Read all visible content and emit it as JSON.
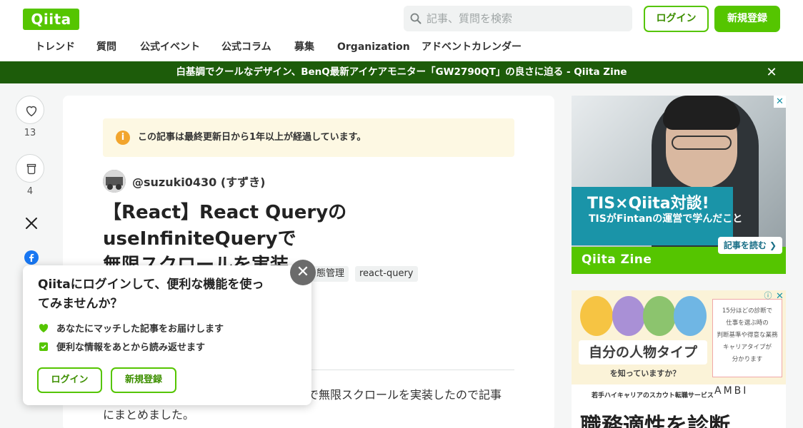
{
  "header": {
    "logo": "Qiita",
    "search_placeholder": "記事、質問を検索",
    "login": "ログイン",
    "signup": "新規登録",
    "nav": [
      "トレンド",
      "質問",
      "公式イベント",
      "公式コラム",
      "募集",
      "Organization",
      "アドベントカレンダー"
    ]
  },
  "banner": {
    "text": "白基調でクールなデザイン、BenQ最新アイケアモニター「GW2790QT」の良さに迫る - Qiita Zine",
    "close": "✕"
  },
  "actions": {
    "likes": "13",
    "stocks": "4"
  },
  "article": {
    "notice": "この記事は最終更新日から1年以上が経過しています。",
    "author": "@suzuki0430 (すずき)",
    "title_line1": "【React】React QueryのuseInfiniteQueryで",
    "title_line2": "無限スクロールを実装",
    "tags": [
      "態管理",
      "react-query"
    ],
    "body_line1": "で無限スクロールを実装したので記事",
    "body_line2": "にまとめました。"
  },
  "popup": {
    "title_line1": "Qiitaにログインして、便利な機能を使っ",
    "title_line2": "てみませんか？",
    "features": [
      "あなたにマッチした記事をお届けします",
      "便利な情報をあとから読み返せます"
    ],
    "login": "ログイン",
    "signup": "新規登録",
    "close": "✕"
  },
  "ads": {
    "ad1": {
      "headline": "TIS×Qiita対談!",
      "subline": "TISがFintanの運営で学んだこと",
      "button": "記事を読む ❯",
      "brand": "Qiita Zine",
      "close": "✕"
    },
    "ad2": {
      "label": "自分の人物タイプ",
      "sub": "を知っていますか？",
      "box_lines": [
        "15分ほどの診断で",
        "仕事を選ぶ時の",
        "判断基準や得意な業務",
        "キャリアタイプが",
        "分かります"
      ],
      "service": "若手ハイキャリアのスカウト転職サービス",
      "ambi": "AMBI",
      "big": "職務適性を診断",
      "close": "✕",
      "info": "ⓘ"
    }
  }
}
